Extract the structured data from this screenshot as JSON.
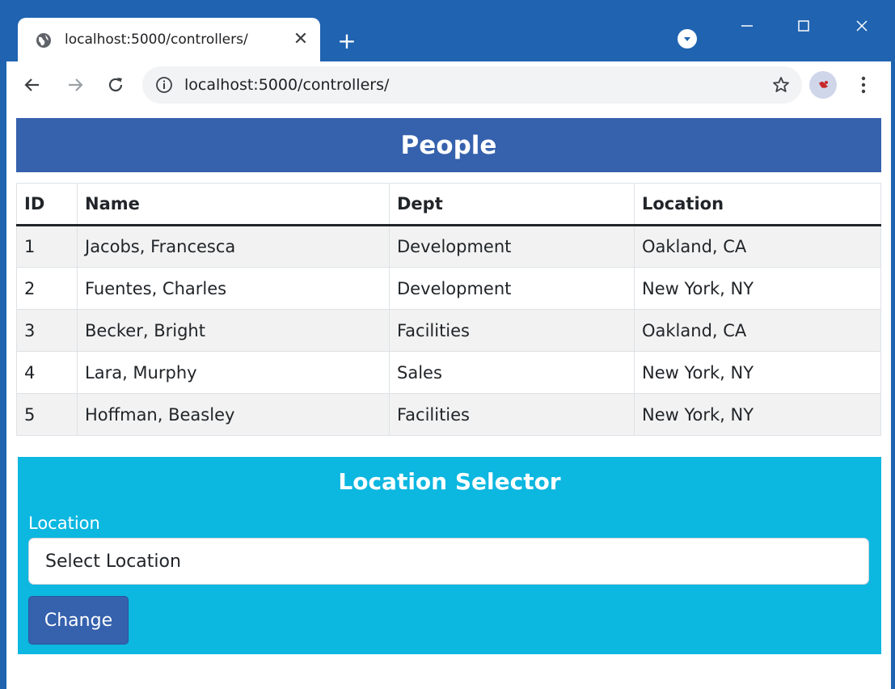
{
  "browser": {
    "tab": {
      "title": "localhost:5000/controllers/",
      "close_glyph": "✕"
    },
    "newtab_glyph": "+",
    "address_bar": {
      "url": "localhost:5000/controllers/"
    },
    "window_controls": {
      "minimize": "—",
      "maximize": "☐",
      "close": "✕"
    },
    "icons": [
      "globe-icon",
      "close-icon",
      "plus-icon",
      "profile-icon",
      "back-arrow-icon",
      "forward-arrow-icon",
      "reload-icon",
      "info-icon",
      "star-icon",
      "avatar-icon",
      "menu-dots-icon"
    ],
    "colors": {
      "frame": "#1f63b1",
      "omnibox": "#f1f3f4"
    }
  },
  "page": {
    "people_title": "People",
    "table": {
      "headers": [
        "ID",
        "Name",
        "Dept",
        "Location"
      ],
      "rows": [
        [
          "1",
          "Jacobs, Francesca",
          "Development",
          "Oakland, CA"
        ],
        [
          "2",
          "Fuentes, Charles",
          "Development",
          "New York, NY"
        ],
        [
          "3",
          "Becker, Bright",
          "Facilities",
          "Oakland, CA"
        ],
        [
          "4",
          "Lara, Murphy",
          "Sales",
          "New York, NY"
        ],
        [
          "5",
          "Hoffman, Beasley",
          "Facilities",
          "New York, NY"
        ]
      ]
    },
    "selector": {
      "title": "Location Selector",
      "label": "Location",
      "select_value": "Select Location",
      "button": "Change"
    },
    "colors": {
      "primary": "#3561ad",
      "info": "#0cb7e0",
      "stripe": "#f2f2f2"
    }
  }
}
